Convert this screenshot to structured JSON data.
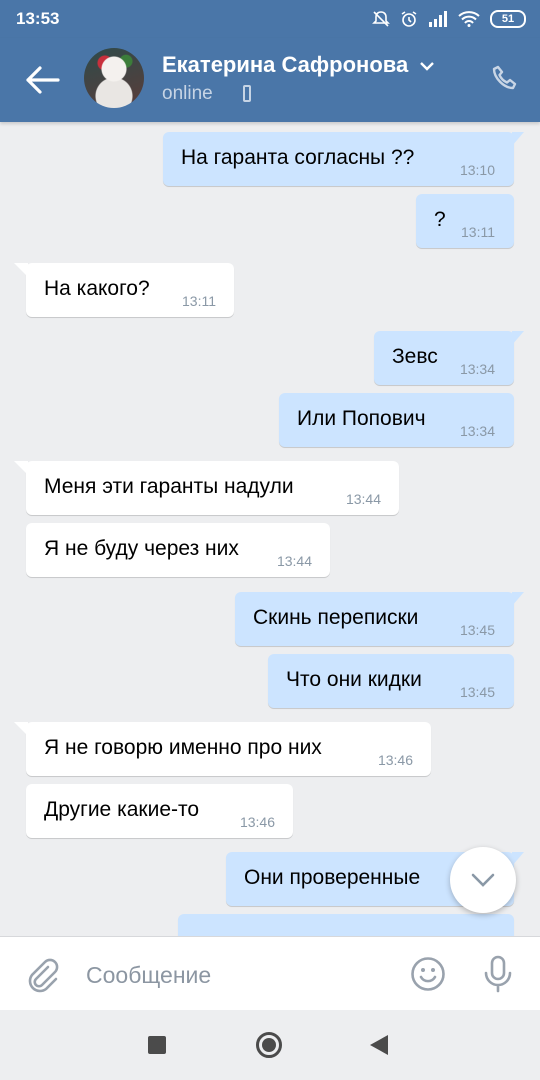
{
  "status_bar": {
    "time": "13:53",
    "battery": "51"
  },
  "header": {
    "contact_name": "Екатерина Сафронова",
    "status": "online"
  },
  "messages": [
    {
      "dir": "out",
      "text": "На гаранта согласны ??",
      "time": "13:10"
    },
    {
      "dir": "out",
      "text": "?",
      "time": "13:11"
    },
    {
      "dir": "in",
      "text": "На какого?",
      "time": "13:11"
    },
    {
      "dir": "out",
      "text": "Зевс",
      "time": "13:34"
    },
    {
      "dir": "out",
      "text": "Или Попович",
      "time": "13:34"
    },
    {
      "dir": "in",
      "text": "Меня эти гаранты надули",
      "time": "13:44"
    },
    {
      "dir": "in",
      "text": "Я не буду через них",
      "time": "13:44"
    },
    {
      "dir": "out",
      "text": "Скинь переписки",
      "time": "13:45"
    },
    {
      "dir": "out",
      "text": "Что они кидки",
      "time": "13:45"
    },
    {
      "dir": "in",
      "text": "Я не говорю именно про них",
      "time": "13:46"
    },
    {
      "dir": "in",
      "text": "Другие какие-то",
      "time": "13:46"
    },
    {
      "dir": "out",
      "text": "Они проверенные",
      "time": ""
    }
  ],
  "composer": {
    "placeholder": "Сообщение"
  },
  "colors": {
    "header": "#4a76a8",
    "outgoing": "#cce4ff",
    "incoming": "#ffffff",
    "background": "#edeef0"
  },
  "icons": [
    "back-arrow-icon",
    "chevron-down-icon",
    "phone-icon",
    "paperclip-icon",
    "smile-icon",
    "microphone-icon",
    "chevron-down-icon"
  ]
}
